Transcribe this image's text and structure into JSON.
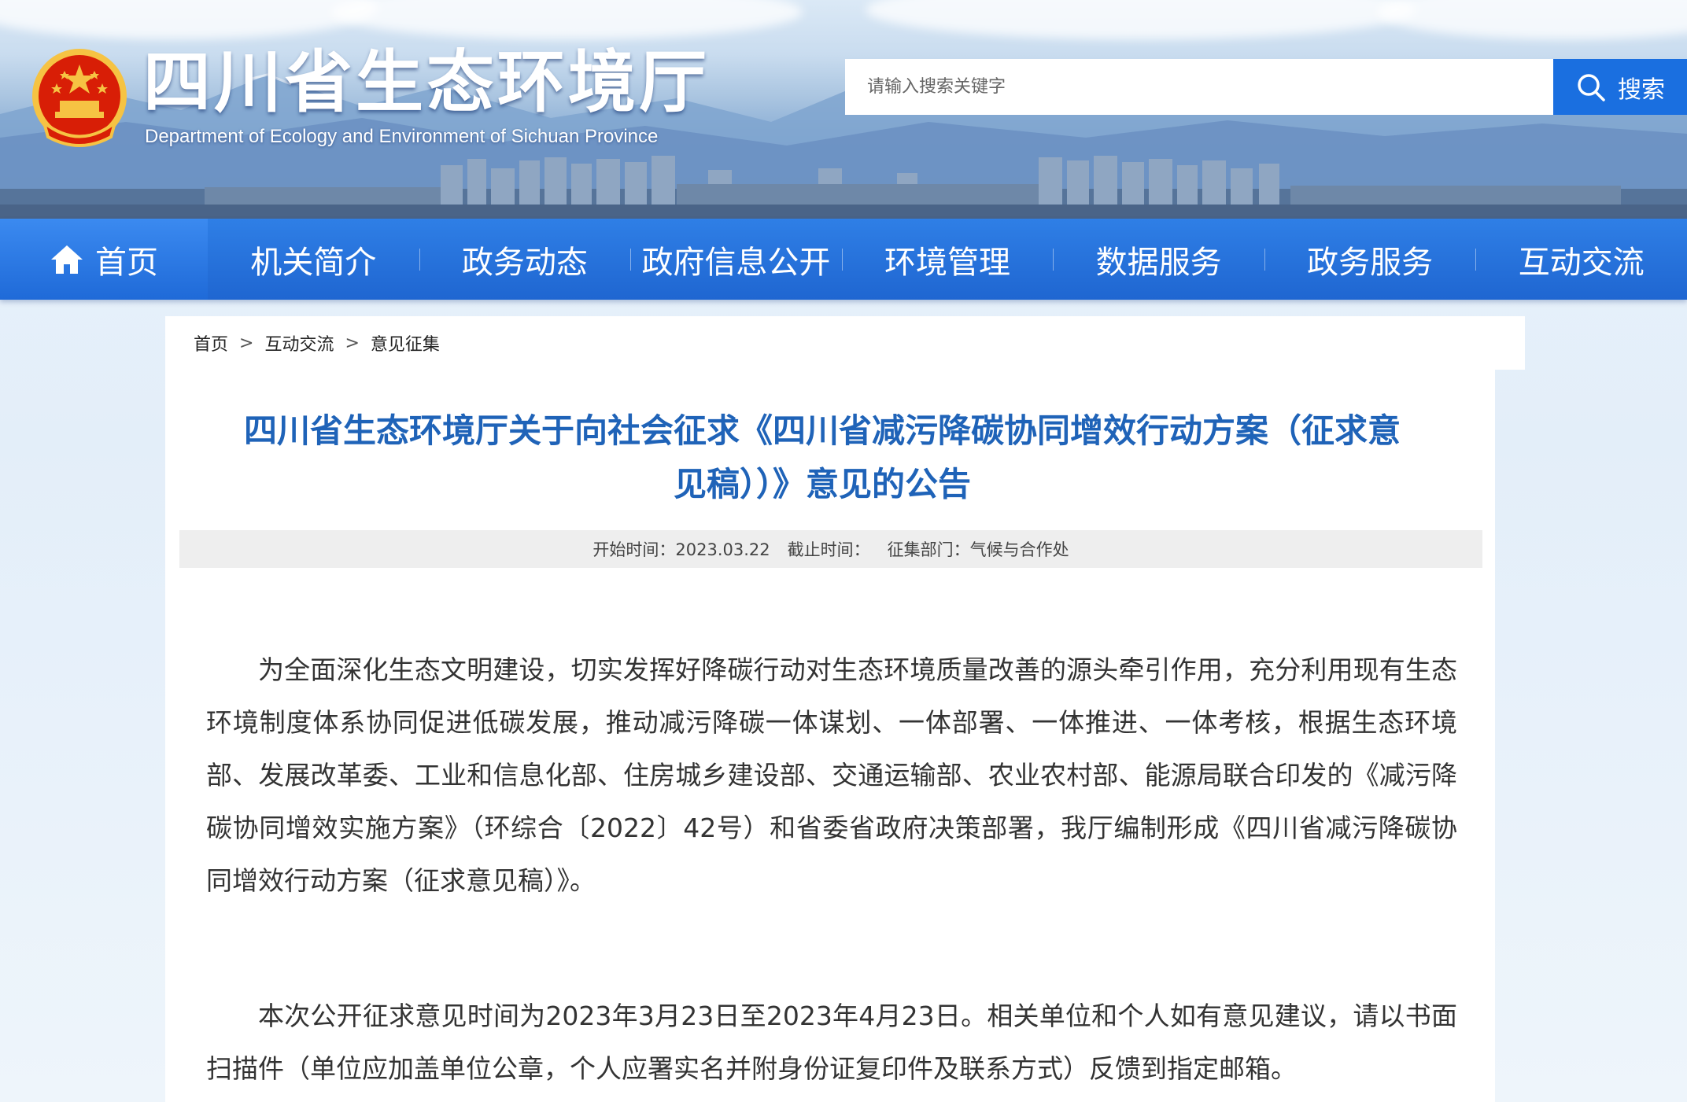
{
  "header": {
    "site_title": "四川省生态环境厅",
    "site_subtitle": "Department of Ecology and Environment of Sichuan Province",
    "search_placeholder": "请输入搜索关键字",
    "search_button_label": "搜索"
  },
  "nav": {
    "home_label": "首页",
    "items": [
      "机关简介",
      "政务动态",
      "政府信息公开",
      "环境管理",
      "数据服务",
      "政务服务",
      "互动交流"
    ]
  },
  "breadcrumb": {
    "items": [
      "首页",
      "互动交流",
      "意见征集"
    ],
    "separator": ">"
  },
  "article": {
    "title": "四川省生态环境厅关于向社会征求《四川省减污降碳协同增效行动方案（征求意见稿））》意见的公告",
    "meta": {
      "start_label": "开始时间：",
      "start_value": "2023.03.22",
      "end_label": "截止时间：",
      "end_value": "",
      "dept_label": "征集部门：",
      "dept_value": "气候与合作处"
    },
    "paragraphs": [
      "为全面深化生态文明建设，切实发挥好降碳行动对生态环境质量改善的源头牵引作用，充分利用现有生态环境制度体系协同促进低碳发展，推动减污降碳一体谋划、一体部署、一体推进、一体考核，根据生态环境部、发展改革委、工业和信息化部、住房城乡建设部、交通运输部、农业农村部、能源局联合印发的《减污降碳协同增效实施方案》（环综合〔2022〕42号）和省委省政府决策部署，我厅编制形成《四川省减污降碳协同增效行动方案（征求意见稿）》。",
      "本次公开征求意见时间为2023年3月23日至2023年4月23日。相关单位和个人如有意见建议，请以书面扫描件（单位应加盖单位公章，个人应署实名并附身份证复印件及联系方式）反馈到指定邮箱。"
    ]
  },
  "colors": {
    "nav_blue": "#1f66d1",
    "search_blue": "#1a6fe0",
    "title_blue": "#1f63b8",
    "emblem_red": "#d81e06",
    "emblem_gold": "#f6c343"
  }
}
